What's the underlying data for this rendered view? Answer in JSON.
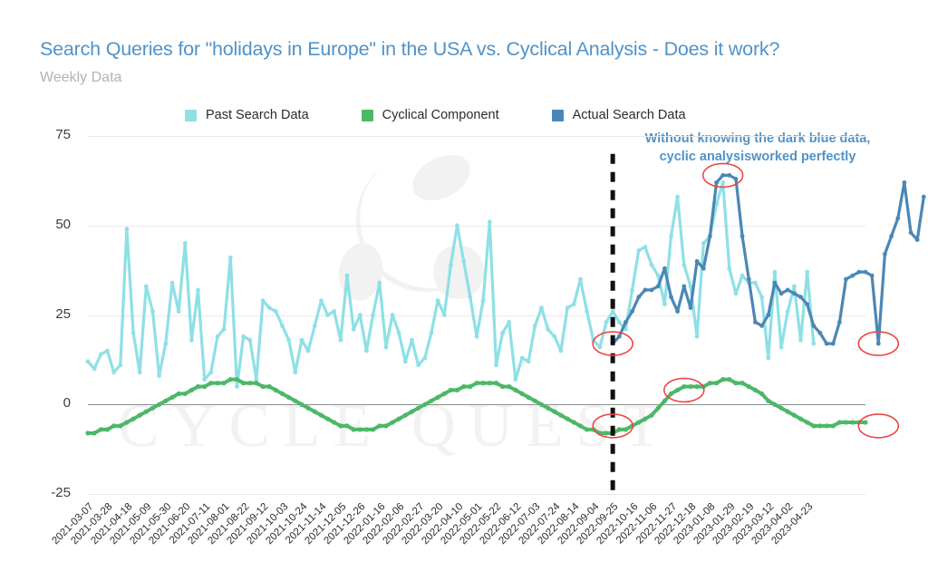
{
  "header": {
    "title": "Search Queries for \"holidays in Europe\" in the USA vs. Cyclical Analysis - Does it work?",
    "subtitle": "Weekly Data",
    "title_color": "#4f93c9",
    "subtitle_color": "#b0b3b6"
  },
  "annotation": {
    "line1": "Without knowing the dark blue data,",
    "line2": "cyclic analysisworked perfectly",
    "color": "#4f93c9"
  },
  "watermark": {
    "text": "CYCLE QUEST",
    "color": "#f2f2f2"
  },
  "chart_data": {
    "type": "line",
    "title": "Search Queries for \"holidays in Europe\" in the USA vs. Cyclical Analysis - Does it work?",
    "subtitle": "Weekly Data",
    "xlabel": "",
    "ylabel": "",
    "ylim": [
      -25,
      75
    ],
    "yticks": [
      75,
      50,
      25,
      0,
      -25
    ],
    "grid": true,
    "legend_position": "top-center",
    "x_start": "2021-03-07",
    "x_end": "2023-04-30",
    "x_interval_weeks": 1,
    "tick_interval_weeks": 3,
    "xtick_labels": [
      "2021-03-07",
      "2021-03-28",
      "2021-04-18",
      "2021-05-09",
      "2021-05-30",
      "2021-06-20",
      "2021-07-11",
      "2021-08-01",
      "2021-08-22",
      "2021-09-12",
      "2021-10-03",
      "2021-10-24",
      "2021-11-14",
      "2021-12-05",
      "2021-12-26",
      "2022-01-16",
      "2022-02-06",
      "2022-02-27",
      "2022-03-20",
      "2022-04-10",
      "2022-05-01",
      "2022-05-22",
      "2022-06-12",
      "2022-07-03",
      "2022-07-24",
      "2022-08-14",
      "2022-09-04",
      "2022-09-25",
      "2022-10-16",
      "2022-11-06",
      "2022-11-27",
      "2022-12-18",
      "2023-01-08",
      "2023-01-29",
      "2023-02-19",
      "2023-03-12",
      "2023-04-02",
      "2023-04-23"
    ],
    "divider": {
      "type": "vline",
      "label": "2022-09-25",
      "index": 81,
      "style": "dashed",
      "color": "#111111",
      "note": "separates past search data from actual search data"
    },
    "series": [
      {
        "name": "Past Search Data",
        "color": "#8ee0e6",
        "marker": "circle",
        "values": [
          12,
          10,
          14,
          15,
          9,
          11,
          49,
          20,
          9,
          33,
          26,
          8,
          17,
          34,
          26,
          45,
          18,
          32,
          7,
          9,
          19,
          21,
          41,
          5,
          19,
          18,
          7,
          29,
          27,
          26,
          22,
          18,
          9,
          18,
          15,
          22,
          29,
          25,
          26,
          18,
          36,
          21,
          25,
          15,
          25,
          34,
          16,
          25,
          20,
          12,
          18,
          11,
          13,
          20,
          29,
          25,
          39,
          50,
          40,
          30,
          19,
          29,
          51,
          11,
          20,
          23,
          7,
          13,
          12,
          22,
          27,
          21,
          19,
          15,
          27,
          28,
          35,
          26,
          18,
          16,
          23,
          26,
          23,
          21,
          32,
          43,
          44,
          39,
          36,
          28,
          47,
          58,
          39,
          33,
          19,
          45,
          47,
          56,
          62,
          38,
          31,
          36,
          34,
          34,
          30,
          13,
          37,
          16,
          26,
          33,
          18,
          37,
          17
        ]
      },
      {
        "name": "Cyclical Component",
        "color": "#4cb867",
        "marker": "circle",
        "values": [
          -8,
          -8,
          -7,
          -7,
          -6,
          -6,
          -5,
          -4,
          -3,
          -2,
          -1,
          0,
          1,
          2,
          3,
          3,
          4,
          5,
          5,
          6,
          6,
          6,
          7,
          7,
          6,
          6,
          6,
          5,
          5,
          4,
          3,
          2,
          1,
          0,
          -1,
          -2,
          -3,
          -4,
          -5,
          -6,
          -6,
          -7,
          -7,
          -7,
          -7,
          -6,
          -6,
          -5,
          -4,
          -3,
          -2,
          -1,
          0,
          1,
          2,
          3,
          4,
          4,
          5,
          5,
          6,
          6,
          6,
          6,
          5,
          5,
          4,
          3,
          2,
          1,
          0,
          -1,
          -2,
          -3,
          -4,
          -5,
          -6,
          -7,
          -7,
          -8,
          -8,
          -8,
          -7,
          -7,
          -6,
          -5,
          -4,
          -3,
          -1,
          1,
          3,
          4,
          5,
          5,
          5,
          5,
          6,
          6,
          7,
          7,
          6,
          6,
          5,
          4,
          3,
          1,
          0,
          -1,
          -2,
          -3,
          -4,
          -5,
          -6,
          -6,
          -6,
          -6,
          -5,
          -5,
          -5,
          -5,
          -5
        ]
      },
      {
        "name": "Actual Search Data",
        "color": "#4a87b5",
        "marker": "circle",
        "start_index": 81,
        "values": [
          17,
          19,
          23,
          26,
          30,
          32,
          32,
          33,
          38,
          30,
          26,
          33,
          27,
          40,
          38,
          47,
          62,
          64,
          64,
          63,
          47,
          35,
          23,
          22,
          25,
          34,
          31,
          32,
          31,
          30,
          28,
          22,
          20,
          17,
          17,
          23,
          35,
          36,
          37,
          37,
          36,
          17,
          42,
          47,
          52,
          62,
          48,
          46,
          58
        ]
      }
    ],
    "highlights": [
      {
        "series": "Actual Search Data",
        "index": 81,
        "value": 17,
        "shape": "ellipse",
        "color": "#ef4444"
      },
      {
        "series": "Actual Search Data",
        "index": 98,
        "value": 64,
        "shape": "ellipse",
        "color": "#ef4444"
      },
      {
        "series": "Actual Search Data",
        "index": 122,
        "value": 17,
        "shape": "ellipse",
        "color": "#ef4444"
      },
      {
        "series": "Cyclical Component",
        "index": 81,
        "value": -6,
        "shape": "ellipse",
        "color": "#ef4444"
      },
      {
        "series": "Cyclical Component",
        "index": 92,
        "value": 4,
        "shape": "ellipse",
        "color": "#ef4444"
      },
      {
        "series": "Cyclical Component",
        "index": 122,
        "value": -6,
        "shape": "ellipse",
        "color": "#ef4444"
      }
    ]
  }
}
